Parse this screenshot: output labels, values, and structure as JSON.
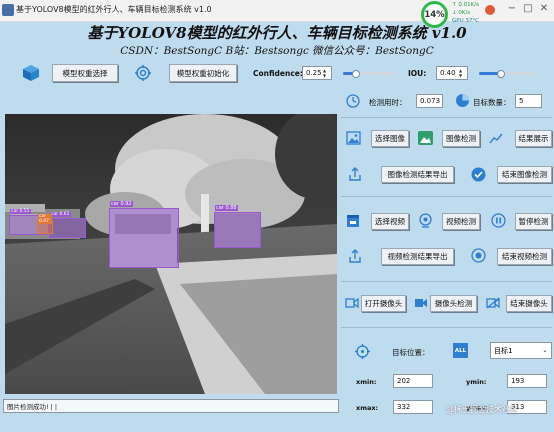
{
  "window": {
    "title": "基于YOLOV8模型的红外行人、车辆目标检测系统 v1.0",
    "cpu_percent": "14%",
    "net_up": "↑ 0.01K/s",
    "net_down": "↓ 0K/s",
    "gpu": "GPU 37°C"
  },
  "header": {
    "title": "基于YOLOV8模型的红外行人、车辆目标检测系统 v1.0",
    "subtitle": "CSDN：BestSongC   B站：Bestsongc   微信公众号：BestSongC"
  },
  "toolbar": {
    "select_weights_label": "模型权重选择",
    "init_weights_label": "模型权重初始化",
    "confidence_label": "Confidence:",
    "confidence_value": "0.25",
    "confidence_slider_fraction": 0.25,
    "iou_label": "IOU:",
    "iou_value": "0.40",
    "iou_slider_fraction": 0.4
  },
  "stats": {
    "time_label": "检测用时：",
    "time_value": "0.073",
    "count_label": "目标数量：",
    "count_value": "5"
  },
  "image_controls": {
    "select_image": "选择图像",
    "image_detect": "图像检测",
    "show_result": "结果展示",
    "export_image": "图像检测结果导出",
    "end_image": "结束图像检测"
  },
  "video_controls": {
    "select_video": "选择视频",
    "video_detect": "视频检测",
    "pause": "暂停检测",
    "export_video": "视频检测结果导出",
    "end_video": "结束视频检测"
  },
  "camera_controls": {
    "open_camera": "打开摄像头",
    "camera_detect": "摄像头检测",
    "end_camera": "结束摄像头"
  },
  "target": {
    "position_label": "目标位置：",
    "all_badge": "ALL",
    "selected": "目标1",
    "xmin_label": "xmin:",
    "xmin_value": "202",
    "ymin_label": "ymin:",
    "ymin_value": "193",
    "xmax_label": "xmax:",
    "xmax_value": "332",
    "ymax_label": "ymax:",
    "ymax_value": "313"
  },
  "detections": [
    {
      "label": "car 0.92"
    },
    {
      "label": "car 0.88"
    },
    {
      "label": "car 0.61"
    },
    {
      "label": "car 0.55"
    },
    {
      "label": "car 0.47"
    }
  ],
  "status": {
    "message": "图片检测成功! | |"
  },
  "watermark": "@稀土掘金技术社区",
  "colors": {
    "background": "#bfdcef",
    "accent": "#3578d8",
    "detection_box": "#9b59d0"
  }
}
